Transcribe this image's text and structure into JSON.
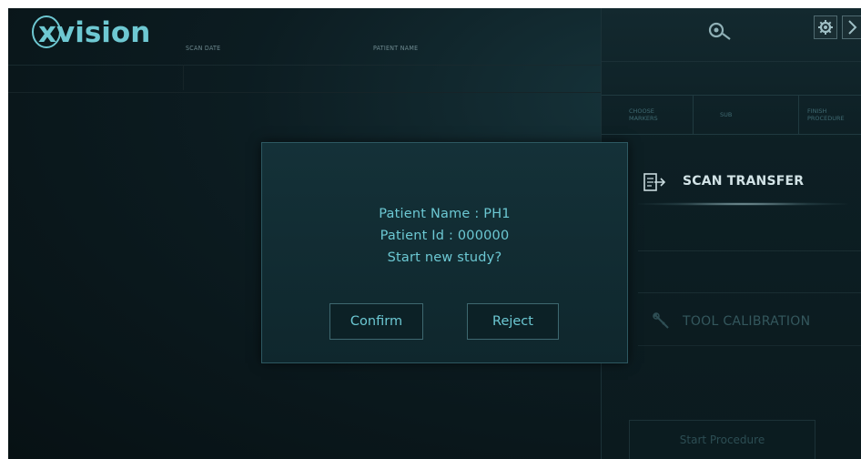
{
  "app": {
    "logo_text": "xvision"
  },
  "table_header": {
    "scan_date": "SCAN DATE",
    "patient_name": "PATIENT NAME"
  },
  "right_panel": {
    "steps": [
      {
        "label": "CHOOSE MARKERS"
      },
      {
        "label": "SUB"
      },
      {
        "label": "FINISH PROCEDURE"
      }
    ],
    "scan_transfer": "SCAN TRANSFER",
    "tool_calibration": "TOOL CALIBRATION",
    "start_procedure": "Start Procedure"
  },
  "dialog": {
    "patient_name_line": "Patient Name : PH1",
    "patient_id_line": "Patient Id : 000000",
    "question": "Start new study?",
    "confirm_label": "Confirm",
    "reject_label": "Reject"
  },
  "icons": {
    "user": "user-icon",
    "settings": "gear-icon",
    "close": "close-icon",
    "scan_transfer": "scan-transfer-icon",
    "tool_calibration": "tool-calibration-icon"
  },
  "colors": {
    "accent": "#6cc8d3",
    "background": "#0c1c21",
    "highlight_text": "#d2e3e6"
  }
}
